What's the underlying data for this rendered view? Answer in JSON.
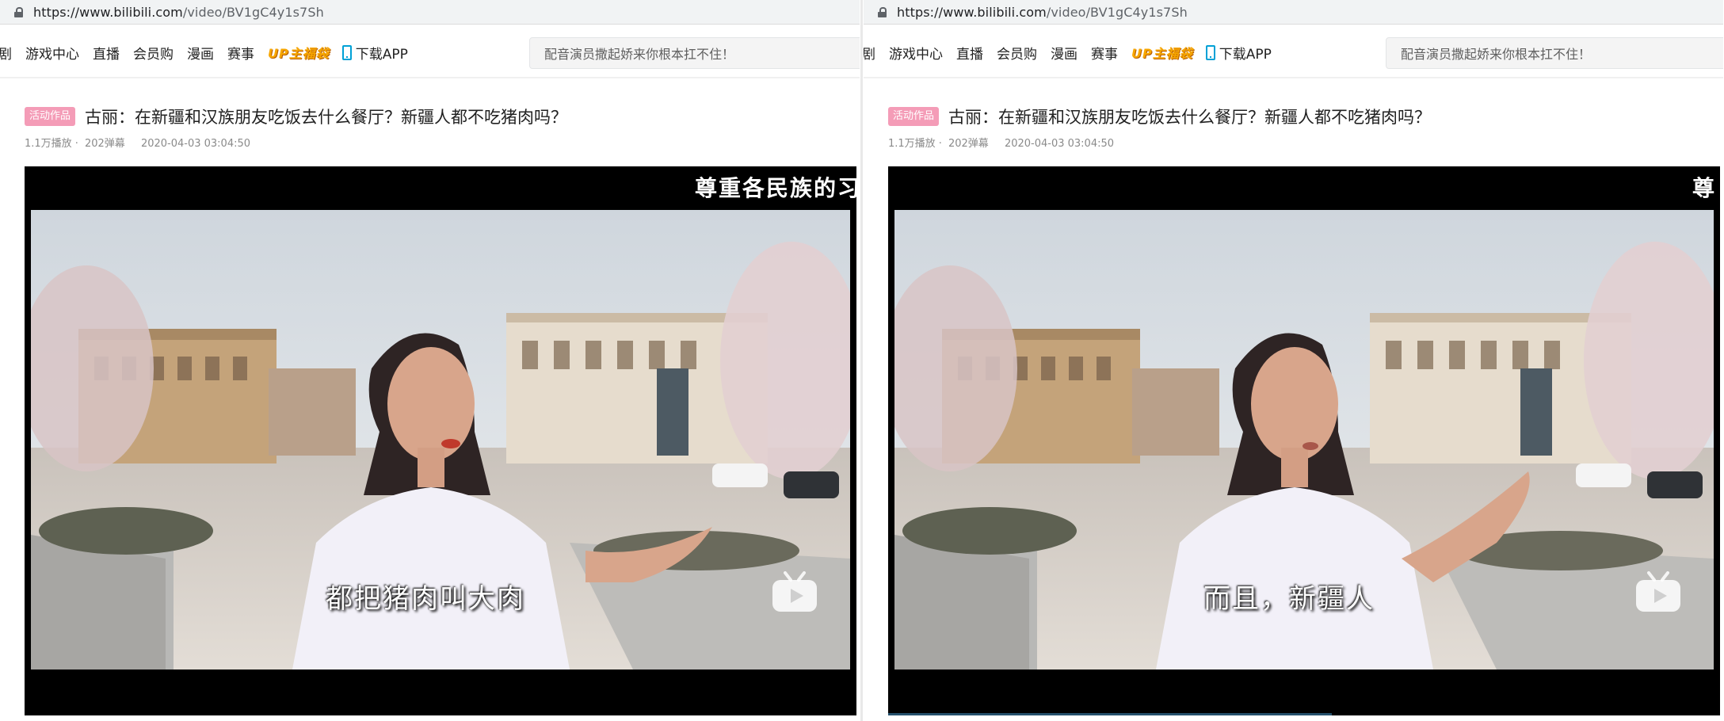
{
  "browser": {
    "url_host": "https://www.bilibili.com",
    "url_path": "/video/BV1gC4y1s7Sh"
  },
  "nav": {
    "items": [
      "番剧",
      "游戏中心",
      "直播",
      "会员购",
      "漫画",
      "赛事"
    ],
    "up_gift": "UP主福袋",
    "download": "下载APP"
  },
  "search": {
    "placeholder": "配音演员撒起娇来你根本扛不住！"
  },
  "video": {
    "tag": "活动作品",
    "title": "古丽：在新疆和汉族朋友吃饭去什么餐厅？新疆人都不吃猪肉吗？",
    "views": "1.1万播放",
    "danmaku": "202弹幕",
    "date": "2020-04-03 03:04:50"
  },
  "frames": [
    {
      "top_caption": "尊重各民族的习",
      "subtitle": "都把猪肉叫大肉"
    },
    {
      "top_caption": "尊",
      "subtitle": "而且，新疆人"
    }
  ],
  "colors": {
    "tag_bg": "#f49cb7",
    "up_gift": "#f7a600",
    "accent": "#00a1d6"
  }
}
